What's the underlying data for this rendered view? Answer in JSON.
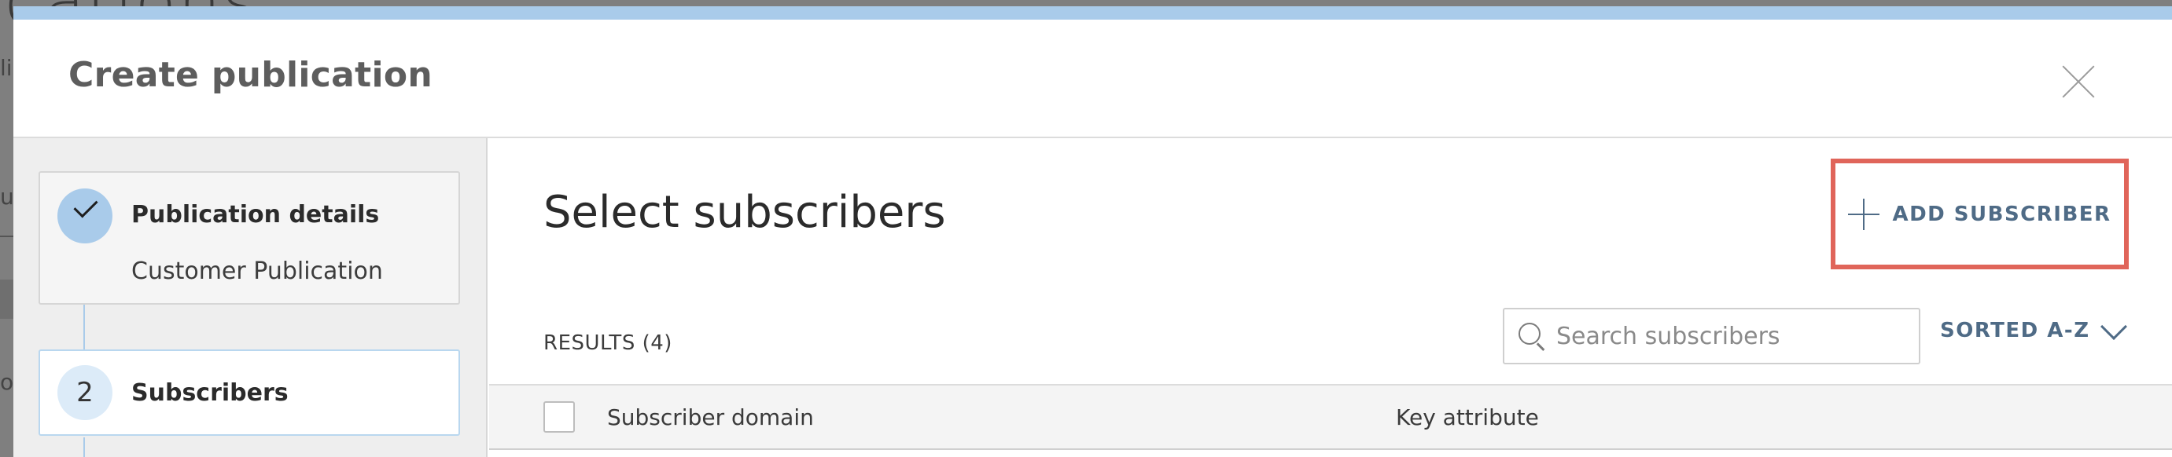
{
  "background": {
    "title_fragment": "ications",
    "fragments": [
      "li",
      "us",
      "o"
    ]
  },
  "modal": {
    "title": "Create publication",
    "close_label": ""
  },
  "steps": [
    {
      "number": "",
      "status": "completed",
      "title": "Publication details",
      "subtitle": "Customer Publication"
    },
    {
      "number": "2",
      "status": "active",
      "title": "Subscribers",
      "subtitle": ""
    }
  ],
  "content": {
    "title": "Select subscribers",
    "add_button_label": "ADD SUBSCRIBER",
    "results_label": "RESULTS (4)",
    "search": {
      "placeholder": "Search subscribers",
      "value": ""
    },
    "sort_label": "SORTED A-Z",
    "table": {
      "columns": [
        "Subscriber domain",
        "Key attribute"
      ]
    }
  },
  "colors": {
    "accent": "#4f6b86",
    "step_completed": "#a9cbea",
    "highlight_box": "#e0655a"
  },
  "icons": {
    "close": "close-icon",
    "check": "check-icon",
    "add": "plus-icon",
    "search": "search-icon",
    "sort": "chevron-down-icon"
  }
}
